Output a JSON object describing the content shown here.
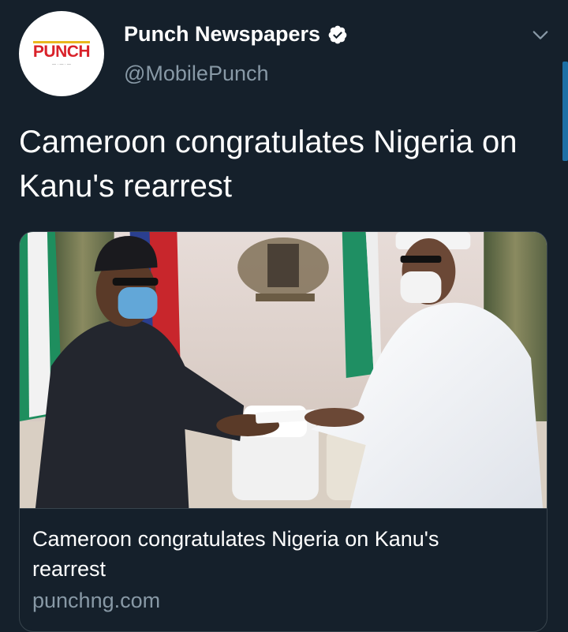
{
  "author": {
    "display_name": "Punch Newspapers",
    "handle": "@MobilePunch",
    "logo_text": "PUNCH",
    "verified": true
  },
  "tweet": {
    "text": "Cameroon congratulates Nigeria on Kanu's rearrest"
  },
  "card": {
    "title": "Cameroon congratulates Nigeria on Kanu's rearrest",
    "domain": "punchng.com",
    "image_description_icon": "photo-icon"
  },
  "colors": {
    "background": "#15202b",
    "secondary_text": "#8899a6",
    "border": "#38444d",
    "accent": "#1d9bf0",
    "brand_red": "#d9222a"
  }
}
